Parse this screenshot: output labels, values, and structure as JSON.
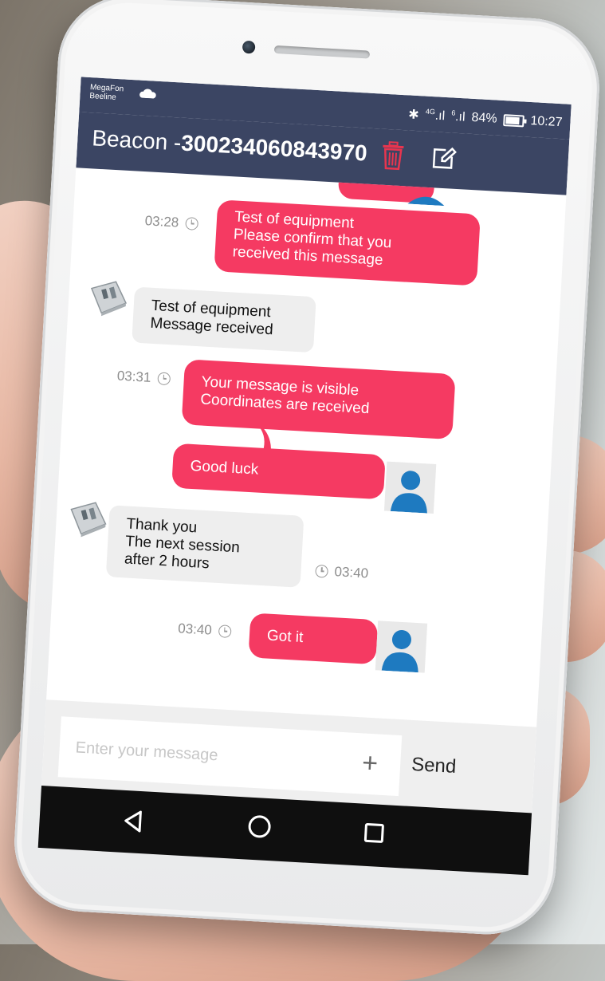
{
  "status_bar": {
    "carrier_1": "MegaFon",
    "carrier_2": "Beeline",
    "network_1": "4G",
    "network_2": "6",
    "battery": "84%",
    "battery_level": 0.84,
    "time": "10:27"
  },
  "header": {
    "title_prefix": "Beacon -",
    "title_number": "300234060843970",
    "trash_color": "#e8354f"
  },
  "messages": [
    {
      "direction": "out",
      "lines": [
        "Test of equipment",
        "Please confirm that you",
        "received this message"
      ],
      "time": "03:28"
    },
    {
      "direction": "in",
      "lines": [
        "Test of equipment",
        "Message received"
      ],
      "time": ""
    },
    {
      "direction": "out",
      "lines": [
        "Your message is visible",
        "Coordinates are received"
      ],
      "time": "03:31"
    },
    {
      "direction": "out",
      "lines": [
        "Good luck"
      ],
      "time": ""
    },
    {
      "direction": "in",
      "lines": [
        "Thank you",
        "The next session",
        "after 2 hours"
      ],
      "time": "03:40"
    },
    {
      "direction": "out",
      "lines": [
        "Got it"
      ],
      "time": "03:40"
    }
  ],
  "composer": {
    "placeholder": "Enter your message",
    "add_icon": "plus-icon",
    "send_label": "Send"
  },
  "nav": {
    "back_icon": "back-triangle-icon",
    "home_icon": "home-circle-icon",
    "recent_icon": "recent-square-icon"
  },
  "colors": {
    "header_bg": "#3b4563",
    "outgoing_bubble": "#f53a62",
    "incoming_bubble": "#eeeeee",
    "user_avatar": "#1e7ac0"
  }
}
